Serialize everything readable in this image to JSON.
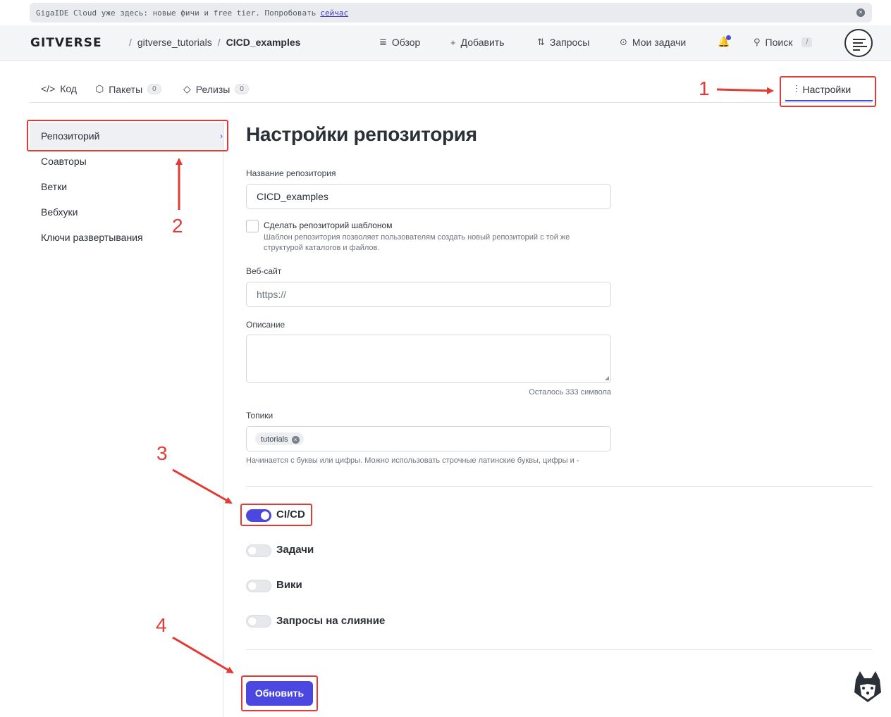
{
  "banner": {
    "text": "GigaIDE Cloud уже здесь: новые фичи и free tier. Попробовать",
    "link": "сейчас",
    "close_icon": "close-icon"
  },
  "header": {
    "logo": "GITVERSE",
    "breadcrumb": {
      "owner": "gitverse_tutorials",
      "repo": "CICD_examples",
      "separator": "/"
    },
    "nav": [
      {
        "label": "Обзор",
        "icon": "overview-icon"
      },
      {
        "label": "Добавить",
        "icon": "plus-icon"
      },
      {
        "label": "Запросы",
        "icon": "pull-request-icon"
      },
      {
        "label": "Мои задачи",
        "icon": "issues-icon"
      }
    ],
    "search": {
      "label": "Поиск",
      "shortcut": "/"
    }
  },
  "tabs": [
    {
      "label": "Код",
      "icon": "code-icon"
    },
    {
      "label": "Пакеты",
      "count": "0",
      "icon": "package-icon"
    },
    {
      "label": "Релизы",
      "count": "0",
      "icon": "tag-icon"
    }
  ],
  "settings_tab": {
    "label": "Настройки",
    "icon": "sliders-icon"
  },
  "sidebar": {
    "items": [
      {
        "label": "Репозиторий",
        "active": true
      },
      {
        "label": "Соавторы"
      },
      {
        "label": "Ветки"
      },
      {
        "label": "Вебхуки"
      },
      {
        "label": "Ключи развертывания"
      }
    ]
  },
  "main": {
    "title": "Настройки репозитория",
    "repo_name": {
      "label": "Название репозитория",
      "value": "CICD_examples"
    },
    "template": {
      "label": "Сделать репозиторий шаблоном",
      "hint": "Шаблон репозитория позволяет пользователям создать новый репозиторий с той же структурой каталогов и файлов.",
      "checked": false
    },
    "website": {
      "label": "Веб-сайт",
      "placeholder": "https://"
    },
    "description": {
      "label": "Описание",
      "value": "",
      "remaining": "Осталось 333 символа"
    },
    "topics": {
      "label": "Топики",
      "chips": [
        "tutorials"
      ],
      "hint": "Начинается с буквы или цифры. Можно использовать строчные латинские буквы, цифры и -"
    },
    "toggles": [
      {
        "label": "CI/CD",
        "on": true
      },
      {
        "label": "Задачи",
        "on": false
      },
      {
        "label": "Вики",
        "on": false
      },
      {
        "label": "Запросы на слияние",
        "on": false
      }
    ],
    "submit": "Обновить"
  },
  "annotations": {
    "numbers": [
      "1",
      "2",
      "3",
      "4"
    ],
    "color": "#e23b36"
  },
  "colors": {
    "accent": "#4a48e0",
    "annotation": "#e23b36"
  }
}
